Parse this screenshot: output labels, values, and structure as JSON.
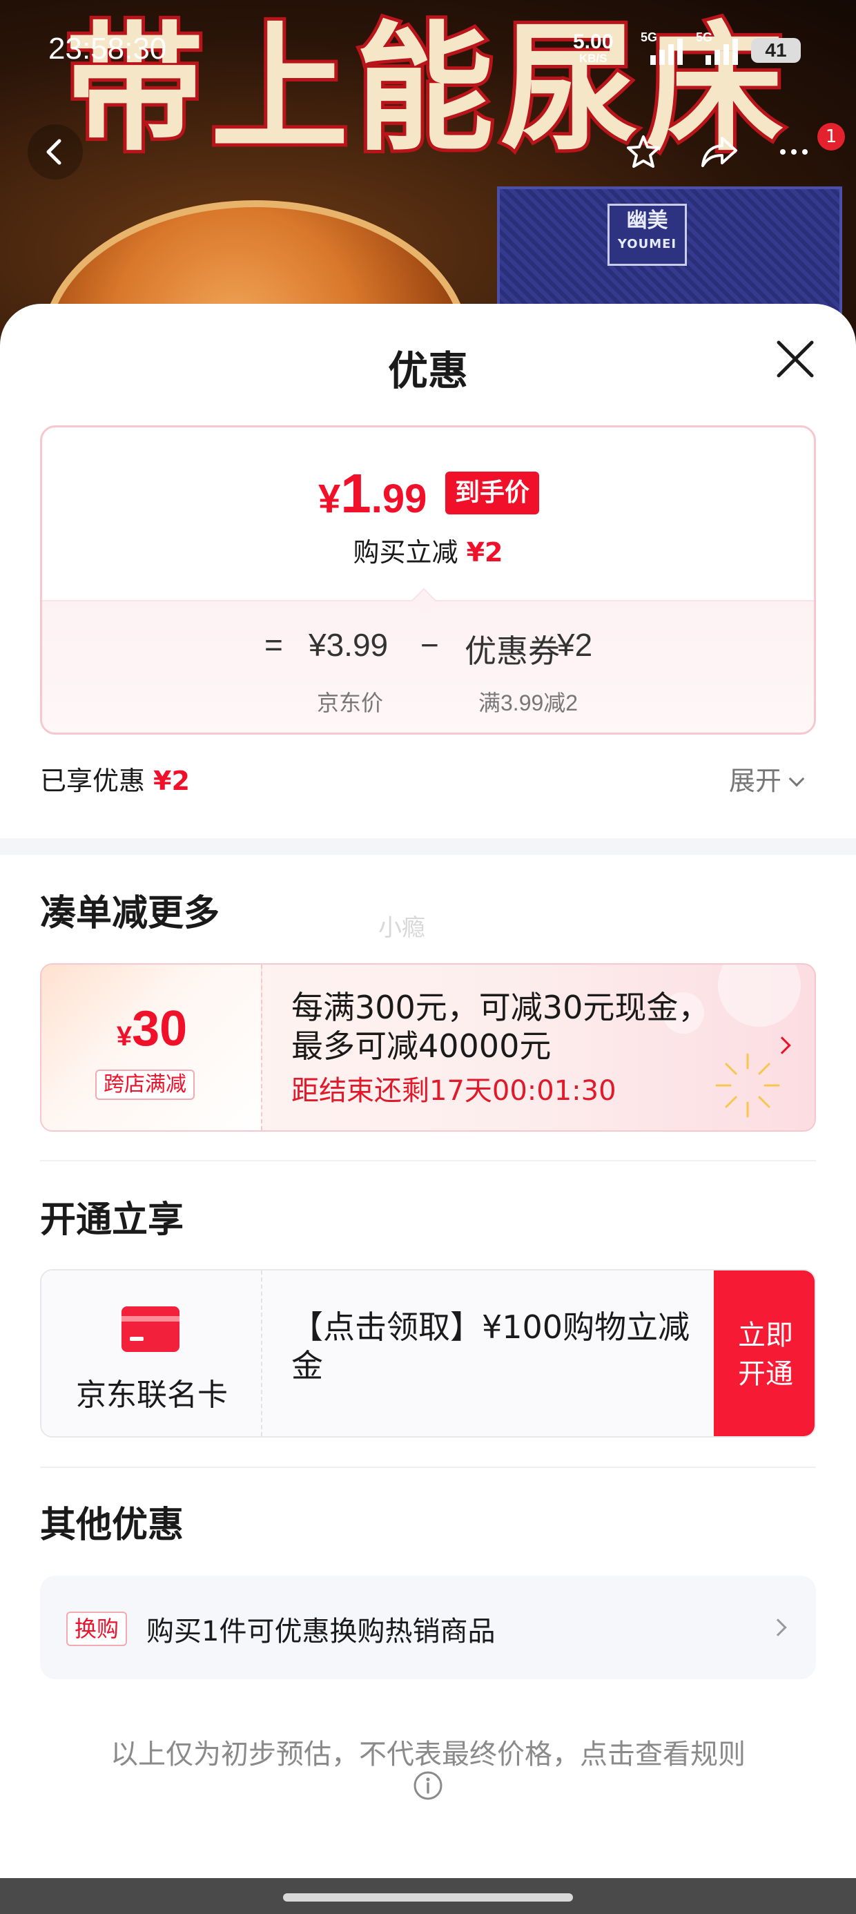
{
  "status_bar": {
    "time": "23:58:30",
    "net_speed": "5.00",
    "net_unit": "KB/S",
    "sim1": "5G",
    "sim2": "5G",
    "battery": "41"
  },
  "product_header": {
    "banner_text": "带上能尿床",
    "brand_logo": "幽美",
    "brand_logo_latin": "YOUMEI",
    "notification_count": "1"
  },
  "sheet": {
    "title": "优惠",
    "price": {
      "symbol": "¥",
      "integer": "1",
      "decimal": ".99",
      "tag": "到手价",
      "buy_reduce_label": "购买立减",
      "buy_reduce_value": "¥2",
      "equals": "=",
      "jd_price": "¥3.99",
      "jd_price_label": "京东价",
      "minus": "−",
      "coupon_label": "优惠券",
      "coupon_value": "¥2",
      "coupon_condition": "满3.99减2"
    },
    "enjoyed": {
      "label": "已享优惠",
      "value": "¥2",
      "expand": "展开"
    },
    "more_section": {
      "title": "凑单减更多",
      "watermark": "小瘾",
      "coupon": {
        "symbol": "¥",
        "amount": "30",
        "tag": "跨店满减",
        "line1": "每满300元，可减30元现金，",
        "line2": "最多可减40000元",
        "timer": "距结束还剩17天00:01:30"
      }
    },
    "open_section": {
      "title": "开通立享",
      "card_name": "京东联名卡",
      "card_text": "【点击领取】¥100购物立减金",
      "button": "立即开通"
    },
    "other_section": {
      "title": "其他优惠",
      "tag": "换购",
      "text": "购买1件可优惠换购热销商品"
    },
    "disclaimer": "以上仅为初步预估，不代表最终价格，点击查看规则"
  },
  "colors": {
    "accent_red": "#f01029",
    "button_red": "#f61a35",
    "text_dark": "#1a1a1a",
    "text_gray": "#777777"
  },
  "icons": [
    "back-arrow-icon",
    "star-icon",
    "share-icon",
    "more-icon",
    "close-icon",
    "chevron-down-icon",
    "chevron-right-icon",
    "credit-card-icon",
    "info-icon"
  ]
}
